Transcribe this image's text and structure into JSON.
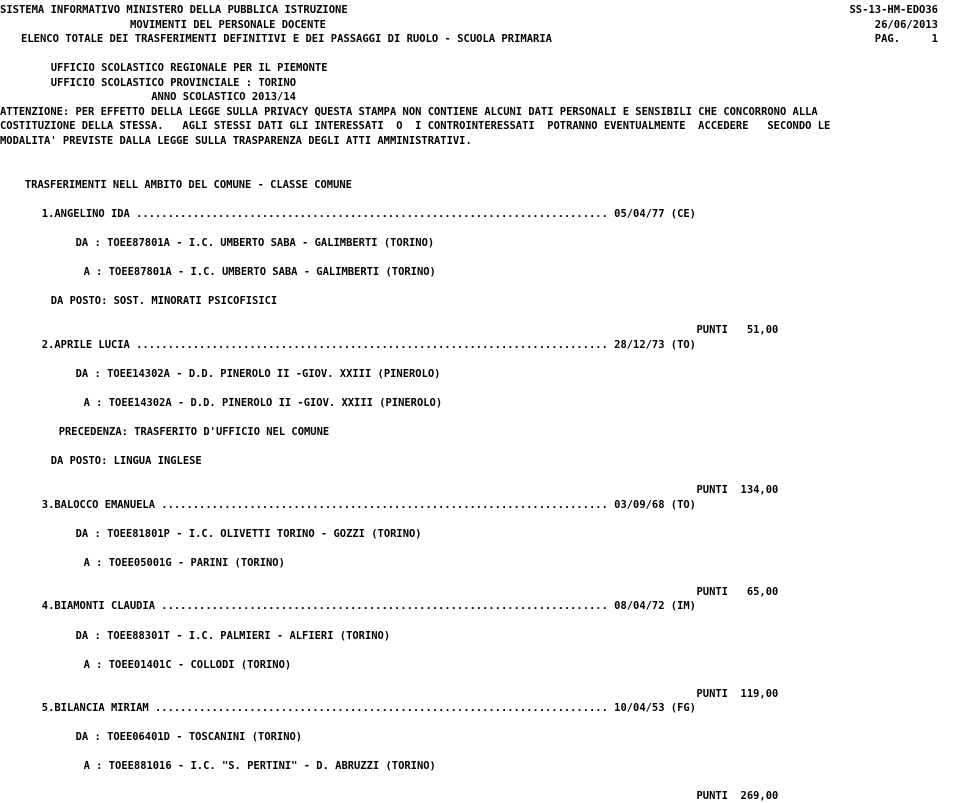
{
  "document": {
    "type": "line-printer-report",
    "page_width_chars": 111,
    "header": {
      "line1_left": "SISTEMA INFORMATIVO MINISTERO DELLA PUBBLICA ISTRUZIONE",
      "line1_right": "SS-13-HM-EDO36",
      "line2_left": "MOVIMENTI DEL PERSONALE DOCENTE",
      "line2_right": "26/06/2013",
      "line3_left": "ELENCO TOTALE DEI TRASFERIMENTI DEFINITIVI E DEI PASSAGGI DI RUOLO - SCUOLA PRIMARIA",
      "line3_right": "PAG.     1",
      "page_label": "PAG.",
      "page_number": "1",
      "report_code": "SS-13-HM-EDO36",
      "report_date": "26/06/2013"
    },
    "office": {
      "regional": "UFFICIO SCOLASTICO REGIONALE PER IL PIEMONTE",
      "provincial": "UFFICIO SCOLASTICO PROVINCIALE : TORINO",
      "school_year": "ANNO SCOLASTICO 2013/14"
    },
    "privacy_notice": {
      "line1": "ATTENZIONE: PER EFFETTO DELLA LEGGE SULLA PRIVACY QUESTA STAMPA NON CONTIENE ALCUNI DATI PERSONALI E SENSIBILI CHE CONCORRONO ALLA",
      "line2": "COSTITUZIONE DELLA STESSA.   AGLI STESSI DATI GLI INTERESSATI  O  I CONTROINTERESSATI  POTRANNO EVENTUALMENTE  ACCEDERE   SECONDO LE",
      "line3": "MODALITA' PREVISTE DALLA LEGGE SULLA TRASPARENZA DEGLI ATTI AMMINISTRATIVI."
    },
    "section_title": "TRASFERIMENTI NELL AMBITO DEL COMUNE - CLASSE COMUNE",
    "labels": {
      "from": "DA :",
      "to": "A :",
      "from_post": "DA POSTO:",
      "precedence": "PRECEDENZA:",
      "points": "PUNTI",
      "dots": "...."
    },
    "entries": [
      {
        "num": "1.",
        "name": "ANGELINO IDA",
        "birth_date": "05/04/77",
        "birth_province": "(CE)",
        "from_code": "TOEE87801A",
        "from_school": "I.C. UMBERTO SABA - GALIMBERTI (TORINO)",
        "from_line": "DA : TOEE87801A - I.C. UMBERTO SABA - GALIMBERTI (TORINO)",
        "to_code": "TOEE87801A",
        "to_school": "I.C. UMBERTO SABA - GALIMBERTI (TORINO)",
        "to_line": "A : TOEE87801A - I.C. UMBERTO SABA - GALIMBERTI (TORINO)",
        "from_post": "DA POSTO: SOST. MINORATI PSICOFISICI",
        "precedence": "",
        "points": "51,00",
        "points_line": "PUNTI   51,00"
      },
      {
        "num": "2.",
        "name": "APRILE LUCIA",
        "birth_date": "28/12/73",
        "birth_province": "(TO)",
        "from_code": "TOEE14302A",
        "from_school": "D.D. PINEROLO II -GIOV. XXIII (PINEROLO)",
        "from_line": "DA : TOEE14302A - D.D. PINEROLO II -GIOV. XXIII (PINEROLO)",
        "to_code": "TOEE14302A",
        "to_school": "D.D. PINEROLO II -GIOV. XXIII (PINEROLO)",
        "to_line": "A : TOEE14302A - D.D. PINEROLO II -GIOV. XXIII (PINEROLO)",
        "from_post": "DA POSTO: LINGUA INGLESE",
        "precedence": "PRECEDENZA: TRASFERITO D'UFFICIO NEL COMUNE",
        "points": "134,00",
        "points_line": "PUNTI  134,00"
      },
      {
        "num": "3.",
        "name": "BALOCCO EMANUELA",
        "birth_date": "03/09/68",
        "birth_province": "(TO)",
        "from_code": "TOEE81801P",
        "from_school": "I.C. OLIVETTI TORINO - GOZZI (TORINO)",
        "from_line": "DA : TOEE81801P - I.C. OLIVETTI TORINO - GOZZI (TORINO)",
        "to_code": "TOEE05001G",
        "to_school": "PARINI (TORINO)",
        "to_line": "A : TOEE05001G - PARINI (TORINO)",
        "from_post": "",
        "precedence": "",
        "points": "65,00",
        "points_line": "PUNTI   65,00"
      },
      {
        "num": "4.",
        "name": "BIAMONTI CLAUDIA",
        "birth_date": "08/04/72",
        "birth_province": "(IM)",
        "from_code": "TOEE88301T",
        "from_school": "I.C. PALMIERI - ALFIERI (TORINO)",
        "from_line": "DA : TOEE88301T - I.C. PALMIERI - ALFIERI (TORINO)",
        "to_code": "TOEE01401C",
        "to_school": "COLLODI (TORINO)",
        "to_line": "A : TOEE01401C - COLLODI (TORINO)",
        "from_post": "",
        "precedence": "",
        "points": "119,00",
        "points_line": "PUNTI  119,00"
      },
      {
        "num": "5.",
        "name": "BILANCIA MIRIAM",
        "birth_date": "10/04/53",
        "birth_province": "(FG)",
        "from_code": "TOEE06401D",
        "from_school": "TOSCANINI (TORINO)",
        "from_line": "DA : TOEE06401D - TOSCANINI (TORINO)",
        "to_code": "TOEE881016",
        "to_school": "I.C. \"S. PERTINI\" - D. ABRUZZI (TORINO)",
        "to_line": "A : TOEE881016 - I.C. \"S. PERTINI\" - D. ABRUZZI (TORINO)",
        "from_post": "",
        "precedence": "",
        "points": "269,00",
        "points_line": "PUNTI  269,00"
      }
    ],
    "rendered_lines": [
      "1.ANGELINO IDA ........................................................................... 05/04/77 (CE)",
      "2.APRILE LUCIA ........................................................................... 28/12/73 (TO)",
      "3.BALOCCO EMANUELA ....................................................................... 03/09/68 (TO)",
      "4.BIAMONTI CLAUDIA ....................................................................... 08/04/72 (IM)",
      "5.BILANCIA MIRIAM ........................................................................ 10/04/53 (FG)"
    ]
  }
}
